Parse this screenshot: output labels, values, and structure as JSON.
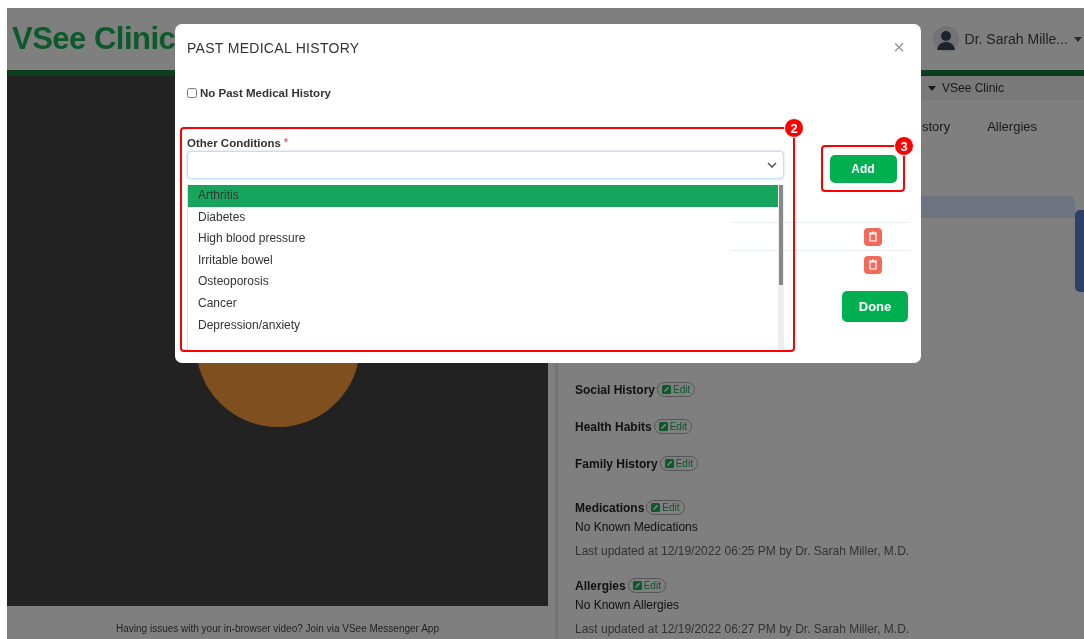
{
  "header": {
    "logo": "VSee Clinic",
    "user_name": "Dr. Sarah Mille..."
  },
  "clinic_bar": {
    "label": "VSee Clinic"
  },
  "tabs": [
    {
      "label": "story",
      "selected": false
    },
    {
      "label": "Allergies",
      "selected": false
    }
  ],
  "video": {
    "footer": "Having issues with your in-browser video? Join via VSee Messenger App"
  },
  "history_sections": [
    {
      "title": "Social History",
      "edit": "Edit"
    },
    {
      "title": "Health Habits",
      "edit": "Edit"
    },
    {
      "title": "Family History",
      "edit": "Edit"
    },
    {
      "title": "Medications",
      "edit": "Edit",
      "value": "No Known Medications",
      "updated": "Last updated at 12/19/2022 06:25 PM by Dr. Sarah Miller, M.D."
    },
    {
      "title": "Allergies",
      "edit": "Edit",
      "value": "No Known Allergies",
      "updated": "Last updated at 12/19/2022 06:27 PM by Dr. Sarah Miller, M.D."
    }
  ],
  "modal": {
    "title": "PAST MEDICAL HISTORY",
    "close": "×",
    "no_history": {
      "label": "No Past Medical History",
      "checked": false
    },
    "field": {
      "label": "Other Conditions",
      "required_mark": "*",
      "annotation": "2"
    },
    "options": [
      {
        "label": "Arthritis",
        "selected": true
      },
      {
        "label": "Diabetes",
        "selected": false
      },
      {
        "label": "High blood pressure",
        "selected": false
      },
      {
        "label": "Irritable bowel",
        "selected": false
      },
      {
        "label": "Osteoporosis",
        "selected": false
      },
      {
        "label": "Cancer",
        "selected": false
      },
      {
        "label": "Depression/anxiety",
        "selected": false
      }
    ],
    "add_button": {
      "label": "Add",
      "annotation": "3"
    },
    "done_button": "Done"
  }
}
